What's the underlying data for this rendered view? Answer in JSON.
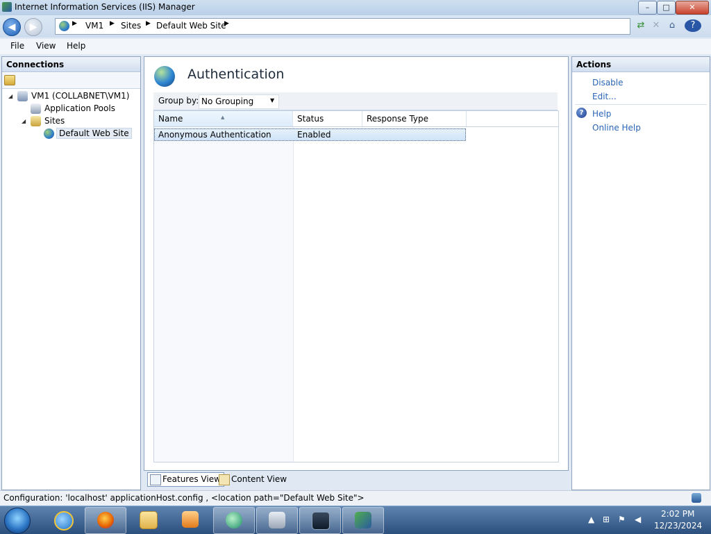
{
  "window": {
    "title": "Internet Information Services (IIS) Manager",
    "controls": {
      "minimize": "–",
      "maximize": "□",
      "close": "✕"
    }
  },
  "nav": {
    "back_icon": "back-arrow-icon",
    "forward_icon": "forward-arrow-icon",
    "breadcrumbs": [
      "VM1",
      "Sites",
      "Default Web Site"
    ],
    "separator": "▶",
    "toolbar_icons": [
      "connect-icon",
      "disconnect-icon",
      "home-icon",
      "help-icon"
    ]
  },
  "menu": {
    "items": [
      "File",
      "View",
      "Help"
    ]
  },
  "connections": {
    "title": "Connections",
    "tree": [
      {
        "label": "VM1 (COLLABNET\\VM1)",
        "icon": "server-icon",
        "expander": "◢"
      },
      {
        "label": "Application Pools",
        "icon": "app-pools-icon"
      },
      {
        "label": "Sites",
        "icon": "sites-folder-icon",
        "expander": "◢"
      },
      {
        "label": "Default Web Site",
        "icon": "globe-icon"
      }
    ]
  },
  "main": {
    "title": "Authentication",
    "group_by_label": "Group by:",
    "group_by_value": "No Grouping",
    "columns": [
      "Name",
      "Status",
      "Response Type"
    ],
    "rows": [
      {
        "name": "Anonymous Authentication",
        "status": "Enabled",
        "response_type": ""
      }
    ],
    "view_tabs": [
      "Features View",
      "Content View"
    ]
  },
  "actions": {
    "title": "Actions",
    "items": [
      "Disable",
      "Edit...",
      "Help",
      "Online Help"
    ]
  },
  "status_bar": {
    "text": "Configuration: 'localhost' applicationHost.config , <location path=\"Default Web Site\">"
  },
  "taskbar": {
    "apps": [
      "internet-explorer-icon",
      "firefox-icon",
      "file-explorer-icon",
      "media-player-icon",
      "remote-desktop-icon",
      "system-tools-icon",
      "task-manager-icon",
      "iis-manager-icon"
    ],
    "clock_time": "2:02 PM",
    "clock_date": "12/23/2024"
  },
  "colors": {
    "accent_link": "#2a66b8",
    "selection": "#cfe3f7",
    "taskbar": "#2c4f7d"
  }
}
